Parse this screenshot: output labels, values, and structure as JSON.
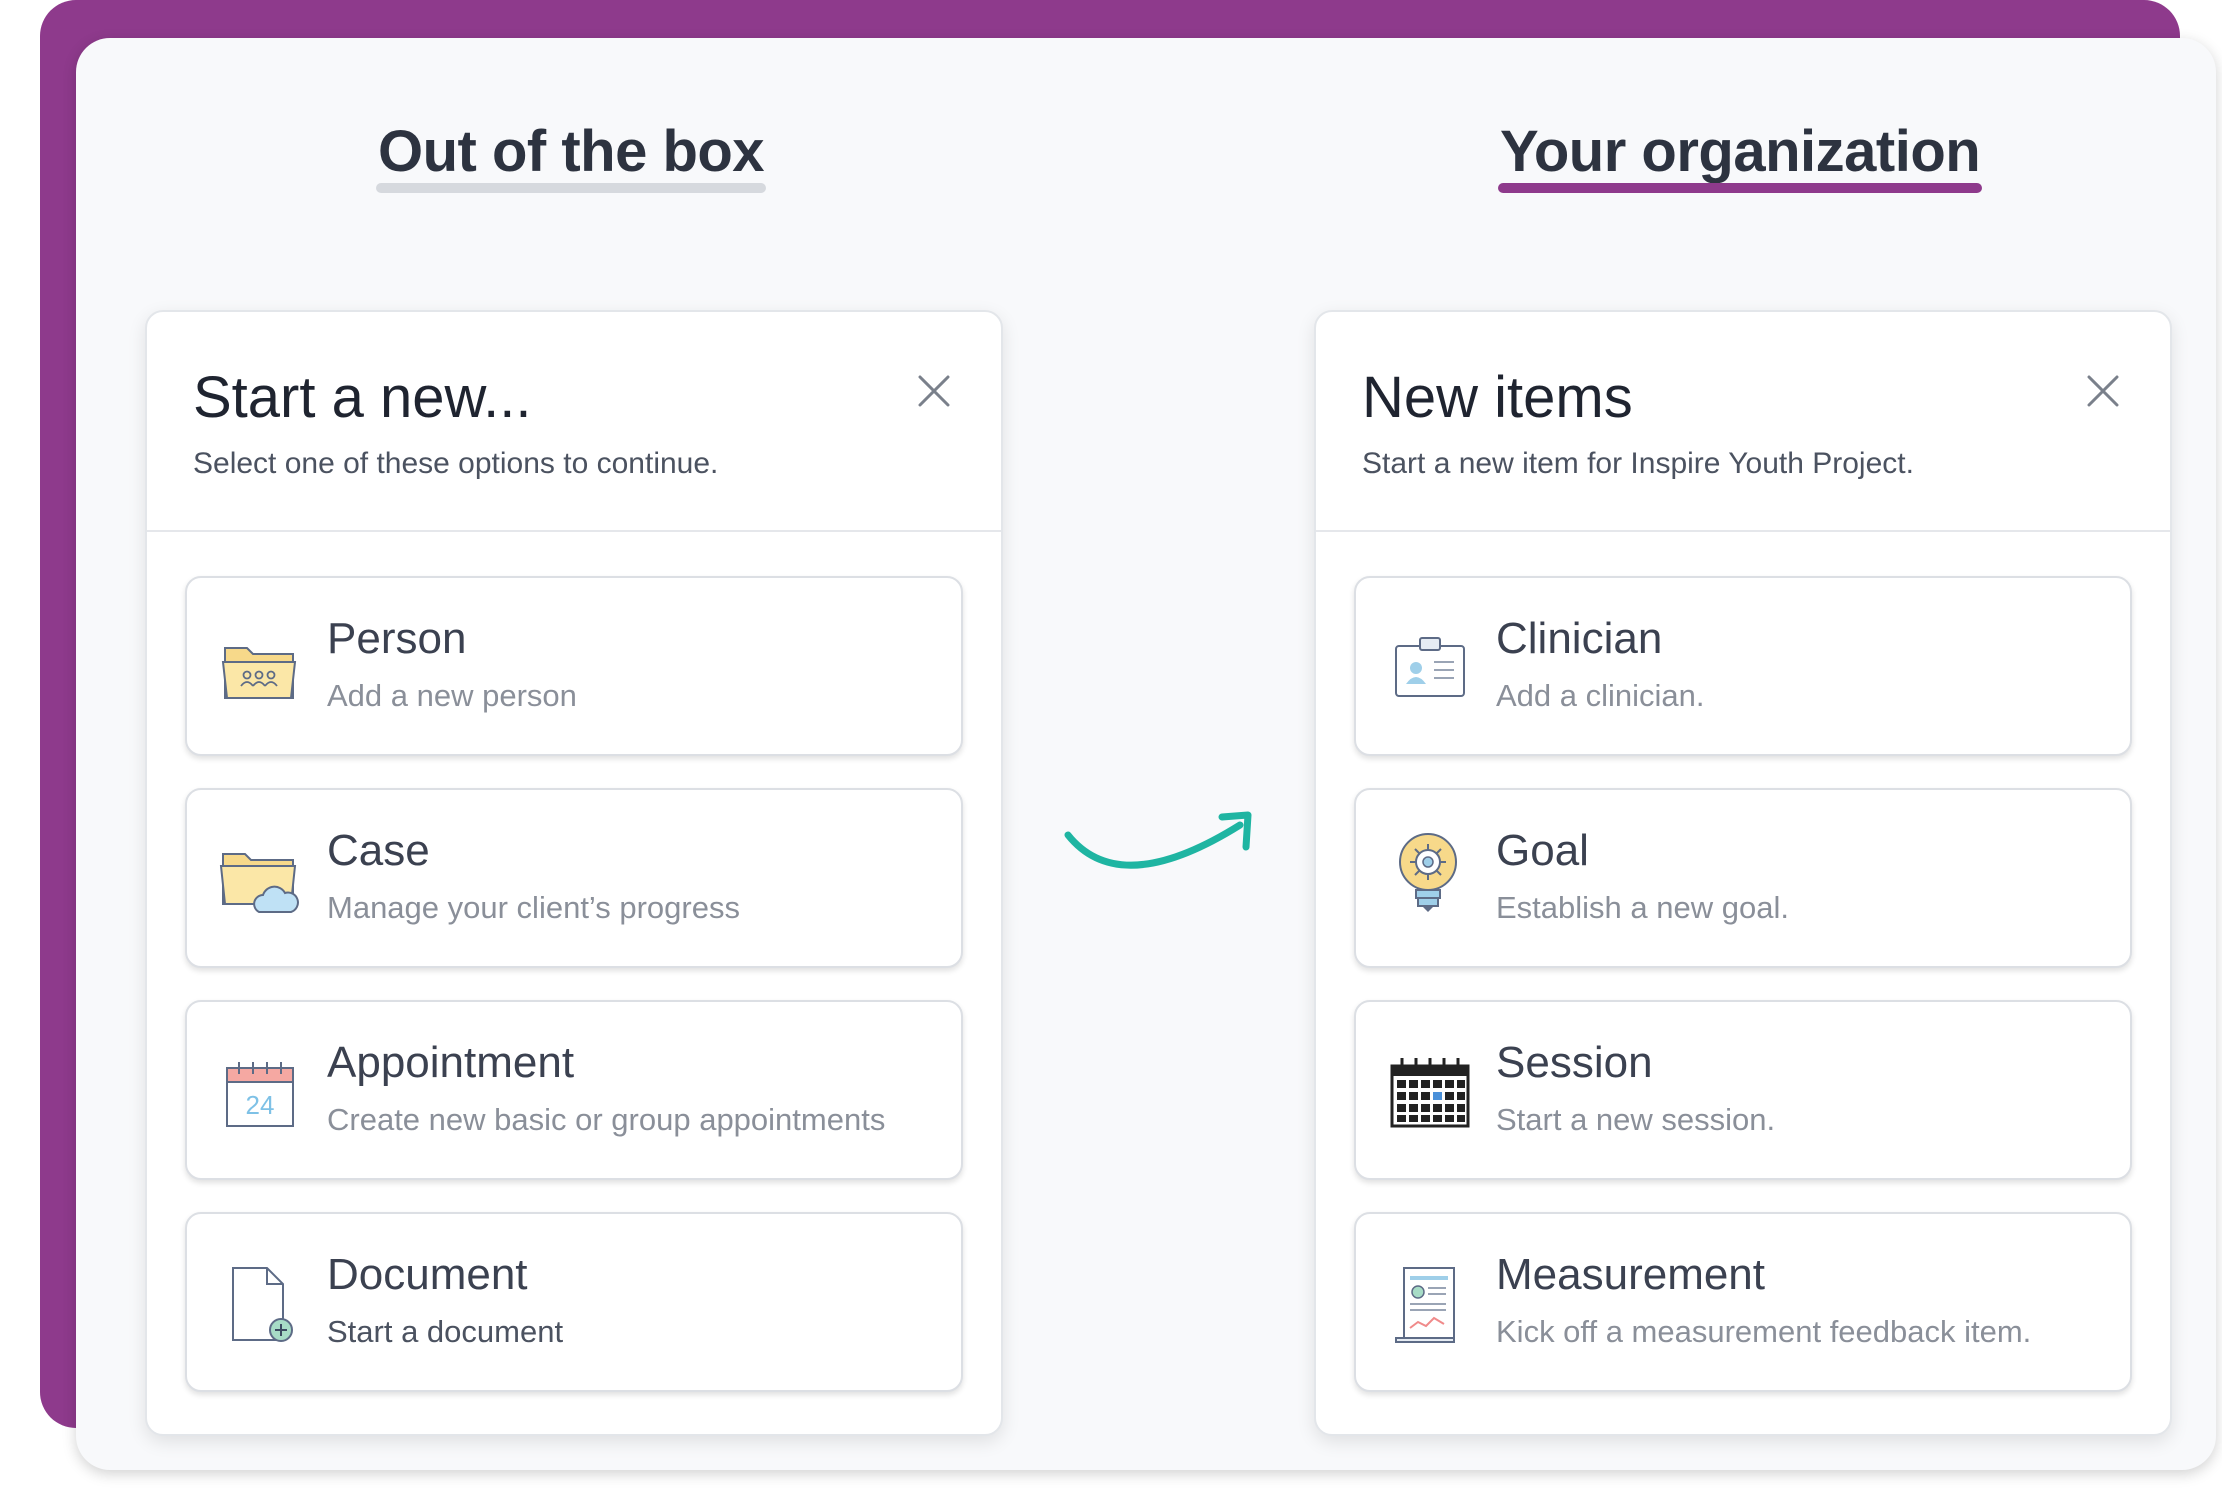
{
  "headings": {
    "left": "Out of the box",
    "right": "Your organization"
  },
  "left_dialog": {
    "title": "Start a new...",
    "subtitle": "Select one of these options to continue.",
    "items": [
      {
        "title": "Person",
        "subtitle": "Add a new person",
        "icon": "folder-people-icon"
      },
      {
        "title": "Case",
        "subtitle": "Manage your client’s progress",
        "icon": "folder-cloud-icon"
      },
      {
        "title": "Appointment",
        "subtitle": "Create new basic or group appointments",
        "icon": "calendar-24-icon"
      },
      {
        "title": "Document",
        "subtitle": "Start a document",
        "icon": "document-add-icon"
      }
    ]
  },
  "right_dialog": {
    "title": "New items",
    "subtitle": "Start a new item for Inspire Youth Project.",
    "items": [
      {
        "title": "Clinician",
        "subtitle": "Add a clinician.",
        "icon": "id-badge-icon"
      },
      {
        "title": "Goal",
        "subtitle": "Establish a new goal.",
        "icon": "lightbulb-gear-icon"
      },
      {
        "title": "Session",
        "subtitle": "Start a new session.",
        "icon": "calendar-grid-icon"
      },
      {
        "title": "Measurement",
        "subtitle": "Kick off a measurement feedback item.",
        "icon": "report-chart-icon"
      }
    ]
  },
  "colors": {
    "brand_purple": "#8e3a8c",
    "arrow_teal": "#1fb5a2"
  }
}
